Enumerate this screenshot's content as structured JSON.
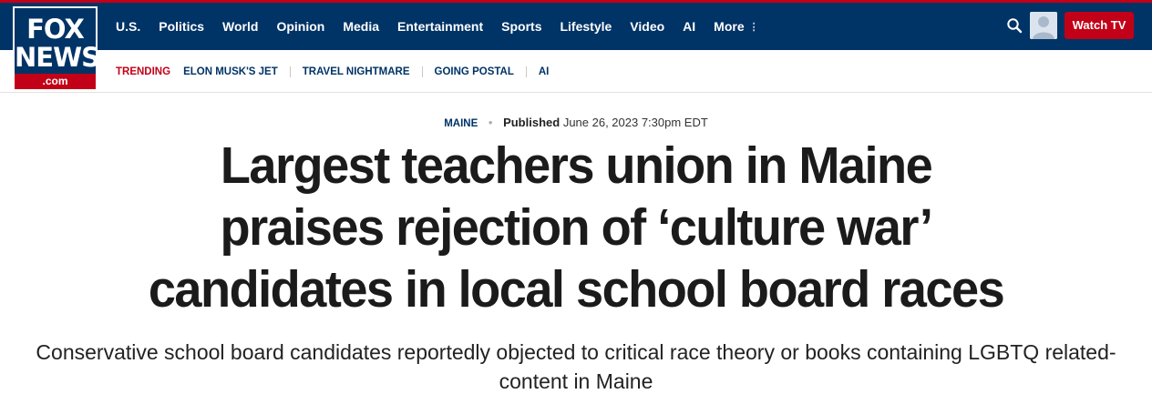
{
  "header": {
    "logo": {
      "line1": "FOX",
      "line2": "NEWS",
      "domain": ".com"
    },
    "nav": [
      "U.S.",
      "Politics",
      "World",
      "Opinion",
      "Media",
      "Entertainment",
      "Sports",
      "Lifestyle",
      "Video",
      "AI"
    ],
    "more_label": "More",
    "more_icon": "vertical-ellipsis-icon",
    "search_icon": "search-icon",
    "avatar_icon": "user-avatar-icon",
    "watch_tv_label": "Watch TV"
  },
  "trending": {
    "label": "TRENDING",
    "items": [
      "ELON MUSK'S JET",
      "TRAVEL NIGHTMARE",
      "GOING POSTAL",
      "AI"
    ]
  },
  "article": {
    "category": "MAINE",
    "published_label": "Published",
    "published_date": "June 26, 2023 7:30pm EDT",
    "headline_lines": [
      "Largest teachers union in Maine",
      "praises rejection of ‘culture war’",
      "candidates in local school board races"
    ],
    "subheadline_lines": [
      "Conservative school board candidates reportedly objected to critical race theory or books containing LGBTQ related-",
      "content in Maine"
    ]
  },
  "colors": {
    "navy": "#003366",
    "red": "#c20017",
    "headline": "#1b1b1b"
  }
}
